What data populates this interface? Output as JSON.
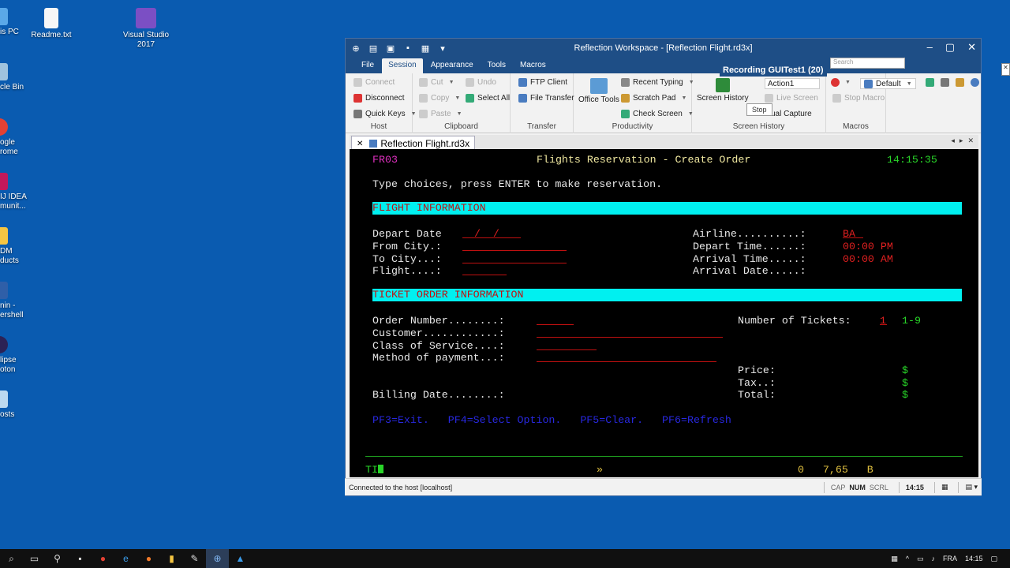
{
  "desktop": {
    "icons_left": [
      {
        "label": "is PC"
      },
      {
        "label": "cle Bin"
      },
      {
        "label": "ogle rome"
      },
      {
        "label": "IJ IDEA munit..."
      },
      {
        "label": "DM ducts"
      },
      {
        "label": "nin - ershell"
      },
      {
        "label": "lipse oton"
      },
      {
        "label": "osts"
      }
    ],
    "readme": "Readme.txt",
    "visual_studio": "Visual Studio 2017"
  },
  "window": {
    "title": "Reflection Workspace - [Reflection Flight.rd3x]",
    "menu_tabs": [
      "File",
      "Session",
      "Appearance",
      "Tools",
      "Macros"
    ],
    "active_tab": "Session",
    "search_placeholder": "Search",
    "recording_badge": "Recording GUITest1 (20)",
    "stop_tooltip": "Stop"
  },
  "ribbon": {
    "host": {
      "label": "Host",
      "connect": "Connect",
      "disconnect": "Disconnect",
      "quick_keys": "Quick Keys"
    },
    "clipboard": {
      "label": "Clipboard",
      "cut": "Cut",
      "undo": "Undo",
      "copy": "Copy",
      "select_all": "Select All",
      "paste": "Paste"
    },
    "transfer": {
      "label": "Transfer",
      "ftp": "FTP Client",
      "file_transfer": "File Transfer"
    },
    "productivity": {
      "label": "Productivity",
      "office_tools": "Office Tools",
      "recent_typing": "Recent Typing",
      "scratch_pad": "Scratch Pad",
      "check_screen": "Check Screen"
    },
    "screen_history": {
      "label": "Screen History",
      "screen_history_btn": "Screen History",
      "action": "Action1",
      "live_screen": "Live Screen",
      "manual_capture": "ual Capture"
    },
    "macros": {
      "label": "Macros",
      "default": "Default",
      "stop_macro": "Stop Macro"
    }
  },
  "doc_tab": {
    "label": "Reflection Flight.rd3x"
  },
  "terminal": {
    "screen_id": "FR03",
    "title": "Flights Reservation - Create Order",
    "time": "14:15:35",
    "instruction": "Type choices, press ENTER to make reservation.",
    "section_flight": "FLIGHT INFORMATION",
    "depart_date_label": "Depart Date",
    "depart_date_value": "  /  /",
    "from_city_label": "From City.:",
    "to_city_label": "To City...:",
    "flight_label": "Flight....:",
    "airline_label": "Airline..........:",
    "airline_value": "BA",
    "depart_time_label": "Depart Time......:",
    "depart_time_value": "00:00 PM",
    "arrival_time_label": "Arrival Time.....:",
    "arrival_time_value": "00:00 AM",
    "arrival_date_label": "Arrival Date.....:",
    "section_ticket": "TICKET ORDER INFORMATION",
    "order_number_label": "Order Number........:",
    "customer_label": "Customer............:",
    "class_label": "Class of Service....:",
    "method_label": "Method of payment...:",
    "billing_label": "Billing Date........:",
    "num_tickets_label": "Number of Tickets:",
    "num_tickets_value": "1",
    "num_tickets_range": "1-9",
    "price_label": "Price:",
    "tax_label": "Tax..:",
    "total_label": "Total:",
    "currency": "$",
    "pf_keys": "PF3=Exit.   PF4=Select Option.   PF5=Clear.   PF6=Refresh",
    "oia_left": "TI",
    "oia_mid": "»",
    "oia_right": "0   7,65   B"
  },
  "statusbar": {
    "message": "Connected to the host [localhost]",
    "cap": "CAP",
    "num": "NUM",
    "scrl": "SCRL",
    "time": "14:15"
  },
  "taskbar": {
    "lang": "FRA",
    "time": "14:15"
  },
  "colors": {
    "ribbon_blue": "#1e4e86",
    "terminal_green": "#28d428",
    "terminal_cyan": "#00f0f0",
    "terminal_red": "#e02020",
    "terminal_magenta": "#e030c0"
  }
}
